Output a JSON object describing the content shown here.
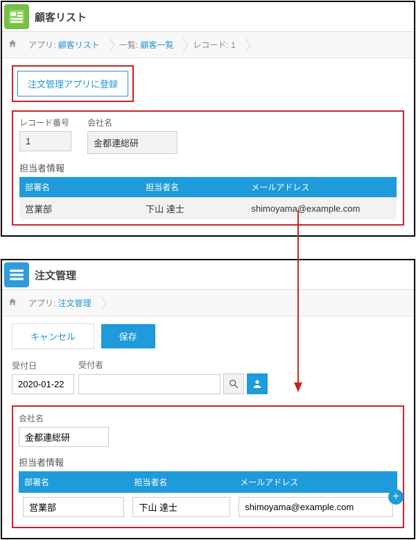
{
  "app1": {
    "title": "顧客リスト",
    "iconColor": "#76c043",
    "breadcrumb": {
      "items": [
        {
          "prefix": "アプリ: ",
          "link": "顧客リスト"
        },
        {
          "prefix": "一覧: ",
          "link": "顧客一覧"
        },
        {
          "prefix": "レコード: ",
          "text": "1"
        }
      ]
    },
    "registerButton": "注文管理アプリに登録",
    "recordNumberLabel": "レコード番号",
    "recordNumberValue": "1",
    "companyLabel": "会社名",
    "companyValue": "金都連総研",
    "contactsTitle": "担当者情報",
    "contactsHeaders": [
      "部署名",
      "担当者名",
      "メールアドレス"
    ],
    "contactsRow": [
      "営業部",
      "下山 達士",
      "shimoyama@example.com"
    ]
  },
  "app2": {
    "title": "注文管理",
    "iconColor": "#319adb",
    "breadcrumb": {
      "items": [
        {
          "prefix": "アプリ: ",
          "link": "注文管理"
        }
      ]
    },
    "buttons": {
      "cancel": "キャンセル",
      "save": "保存"
    },
    "dateLabel": "受付日",
    "dateValue": "2020-01-22",
    "receiverLabel": "受付者",
    "receiverValue": "",
    "companyLabel": "会社名",
    "companyValue": "金都連総研",
    "contactsTitle": "担当者情報",
    "contactsHeaders": [
      "部署名",
      "担当者名",
      "メールアドレス"
    ],
    "contactsRow": [
      "営業部",
      "下山 達士",
      "shimoyama@example.com"
    ],
    "addRowLabel": "+"
  }
}
